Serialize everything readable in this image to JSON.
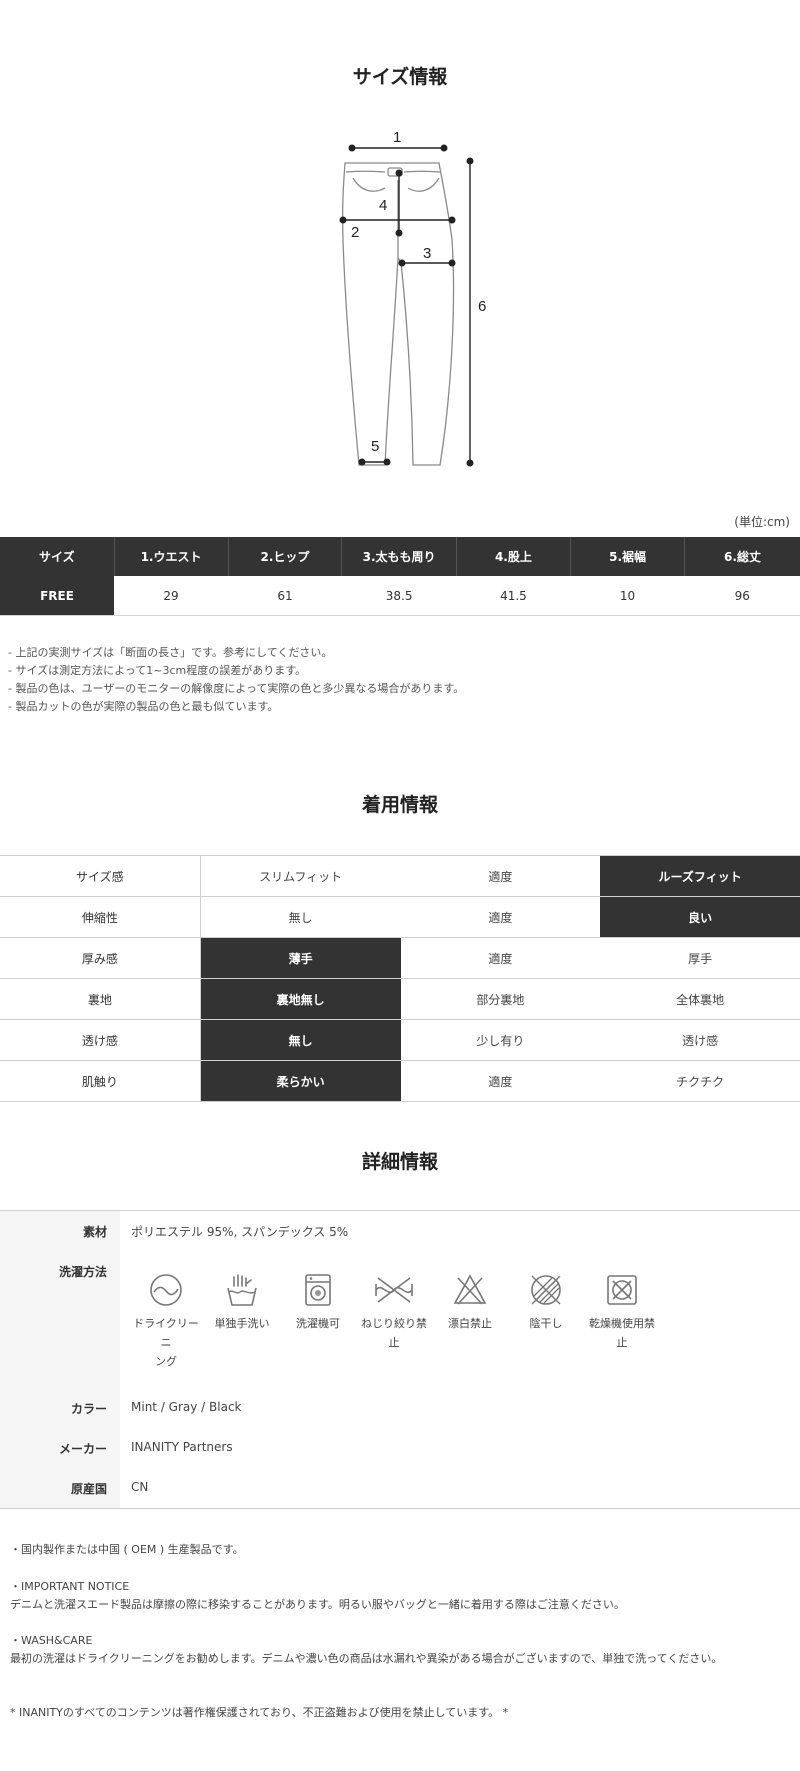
{
  "size_info": {
    "title": "サイズ情報",
    "diagram_labels": [
      "1",
      "2",
      "3",
      "4",
      "5",
      "6"
    ],
    "unit": "(単位:cm)",
    "headers": [
      "サイズ",
      "1.ウエスト",
      "2.ヒップ",
      "3.太もも周り",
      "4.股上",
      "5.裾幅",
      "6.総丈"
    ],
    "row": [
      "FREE",
      "29",
      "61",
      "38.5",
      "41.5",
      "10",
      "96"
    ],
    "notes": [
      "- 上記の実測サイズは「断面の長さ」です。参考にしてください。",
      "- サイズは測定方法によって1~3cm程度の誤差があります。",
      "- 製品の色は、ユーザーのモニターの解像度によって実際の色と多少異なる場合があります。",
      "- 製品カットの色が実際の製品の色と最も似ています。"
    ]
  },
  "fit_info": {
    "title": "着用情報",
    "rows": [
      {
        "label": "サイズ感",
        "options": [
          "スリムフィット",
          "適度",
          "ルーズフィット"
        ],
        "selected": 2
      },
      {
        "label": "伸縮性",
        "options": [
          "無し",
          "適度",
          "良い"
        ],
        "selected": 2
      },
      {
        "label": "厚み感",
        "options": [
          "薄手",
          "適度",
          "厚手"
        ],
        "selected": 0
      },
      {
        "label": "裏地",
        "options": [
          "裏地無し",
          "部分裏地",
          "全体裏地"
        ],
        "selected": 0
      },
      {
        "label": "透け感",
        "options": [
          "無し",
          "少し有り",
          "透け感"
        ],
        "selected": 0
      },
      {
        "label": "肌触り",
        "options": [
          "柔らかい",
          "適度",
          "チクチク"
        ],
        "selected": 0
      }
    ]
  },
  "detail_info": {
    "title": "詳細情報",
    "material_label": "素材",
    "material": "ポリエステル 95%, スパンデックス 5%",
    "wash_label": "洗濯方法",
    "wash_icons": [
      {
        "icon": "dry-clean-icon",
        "line1": "ドライクリーニ",
        "line2": "ング"
      },
      {
        "icon": "hand-wash-icon",
        "line1": "単独手洗い",
        "line2": ""
      },
      {
        "icon": "machine-wash-icon",
        "line1": "洗濯機可",
        "line2": ""
      },
      {
        "icon": "no-wring-icon",
        "line1": "ねじり絞り禁止",
        "line2": ""
      },
      {
        "icon": "no-bleach-icon",
        "line1": "漂白禁止",
        "line2": ""
      },
      {
        "icon": "shade-dry-icon",
        "line1": "陰干し",
        "line2": ""
      },
      {
        "icon": "no-tumble-dry-icon",
        "line1": "乾燥機使用禁止",
        "line2": ""
      }
    ],
    "color_label": "カラー",
    "color": "Mint / Gray / Black",
    "maker_label": "メーカー",
    "maker": "INANITY Partners",
    "origin_label": "原産国",
    "origin": "CN"
  },
  "bottom_notes": {
    "origin_note": "・国内製作または中国 ( OEM ) 生産製品です。",
    "important_title": "・IMPORTANT NOTICE",
    "important_text": "デニムと洗濯スエード製品は摩擦の際に移染することがあります。明るい服やバッグと一緒に着用する際はご注意ください。",
    "care_title": "・WASH&CARE",
    "care_text": "最初の洗濯はドライクリーニングをお勧めします。デニムや濃い色の商品は水漏れや異染がある場合がございますので、単独で洗ってください。",
    "copyright": "* INANITYのすべてのコンテンツは著作権保護されており、不正盗難および使用を禁止しています。 *"
  }
}
